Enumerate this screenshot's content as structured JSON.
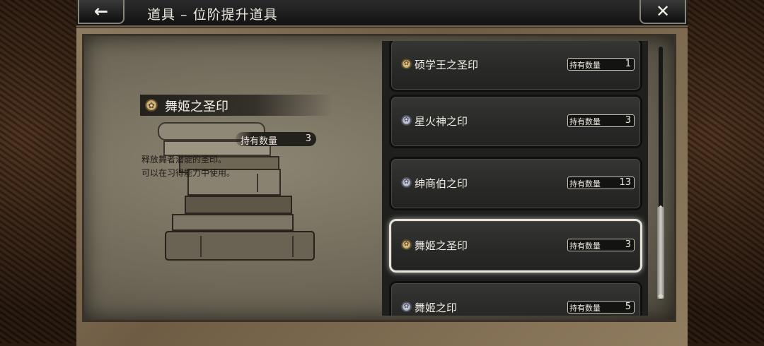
{
  "header": {
    "title": "道具 – 位阶提升道具",
    "back_icon": "arrow-left-icon",
    "close_icon": "close-icon"
  },
  "detail": {
    "name": "舞姬之圣印",
    "count_label": "持有数量",
    "count": "3",
    "description_line1": "释放舞者潜能的圣印。",
    "description_line2": "可以在习得能力中使用。",
    "icon": "gold-seal-icon"
  },
  "list": {
    "items": [
      {
        "name": "硕学王之圣印",
        "count_label": "持有数量",
        "count": "1",
        "icon": "gold-seal-icon",
        "selected": false
      },
      {
        "name": "星火神之印",
        "count_label": "持有数量",
        "count": "3",
        "icon": "silver-seal-icon",
        "selected": false
      },
      {
        "name": "绅商伯之印",
        "count_label": "持有数量",
        "count": "13",
        "icon": "silver-seal-icon",
        "selected": false
      },
      {
        "name": "舞姬之圣印",
        "count_label": "持有数量",
        "count": "3",
        "icon": "gold-seal-icon",
        "selected": true
      },
      {
        "name": "舞姬之印",
        "count_label": "持有数量",
        "count": "5",
        "icon": "silver-seal-icon",
        "selected": false
      }
    ]
  },
  "colors": {
    "selected_border": "#e7e3d8",
    "gold_seal": "#d9c07a",
    "silver_seal": "#b8bdcc"
  }
}
